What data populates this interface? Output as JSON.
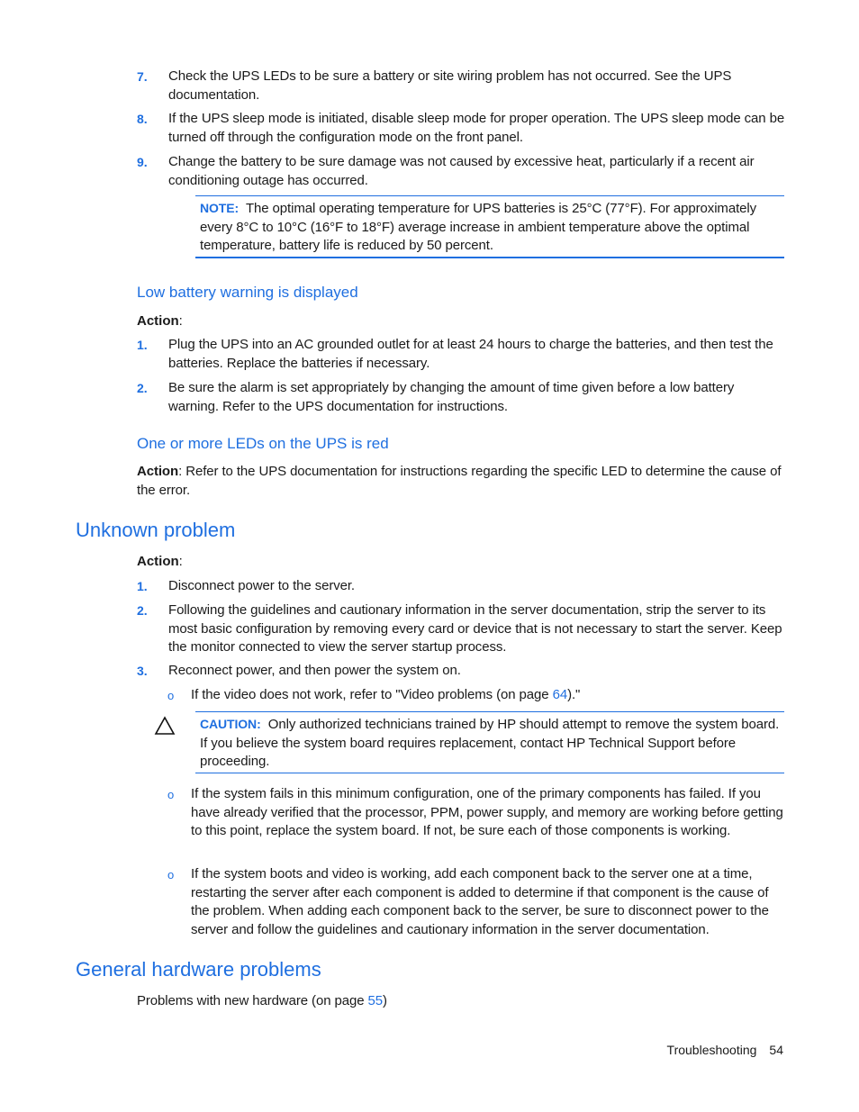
{
  "colors": {
    "accent": "#1f6fe0",
    "text": "#1a1a1a"
  },
  "ups_steps": [
    {
      "num": "7.",
      "text": "Check the UPS LEDs to be sure a battery or site wiring problem has not occurred. See the UPS documentation."
    },
    {
      "num": "8.",
      "text": "If the UPS sleep mode is initiated, disable sleep mode for proper operation. The UPS sleep mode can be turned off through the configuration mode on the front panel."
    },
    {
      "num": "9.",
      "text": "Change the battery to be sure damage was not caused by excessive heat, particularly if a recent air conditioning outage has occurred."
    }
  ],
  "note": {
    "label": "NOTE:",
    "text": "The optimal operating temperature for UPS batteries is 25°C (77°F). For approximately every 8°C to 10°C (16°F to 18°F) average increase in ambient temperature above the optimal temperature, battery life is reduced by 50 percent."
  },
  "low_battery": {
    "heading": "Low battery warning is displayed",
    "action_label": "Action",
    "action_colon": ":",
    "steps": [
      {
        "num": "1.",
        "text": "Plug the UPS into an AC grounded outlet for at least 24 hours to charge the batteries, and then test the batteries. Replace the batteries if necessary."
      },
      {
        "num": "2.",
        "text": "Be sure the alarm is set appropriately by changing the amount of time given before a low battery warning. Refer to the UPS documentation for instructions."
      }
    ]
  },
  "leds_red": {
    "heading": "One or more LEDs on the UPS is red",
    "action_label": "Action",
    "action_text": ": Refer to the UPS documentation for instructions regarding the specific LED to determine the cause of the error."
  },
  "unknown_problem": {
    "heading": "Unknown problem",
    "action_label": "Action",
    "action_colon": ":",
    "steps": [
      {
        "num": "1.",
        "text": "Disconnect power to the server."
      },
      {
        "num": "2.",
        "text": "Following the guidelines and cautionary information in the server documentation, strip the server to its most basic configuration by removing every card or device that is not necessary to start the server. Keep the monitor connected to view the server startup process."
      },
      {
        "num": "3.",
        "text": "Reconnect power, and then power the system on."
      }
    ],
    "sub_bullet_symbol": "o",
    "video_sub": {
      "before": "If the video does not work, refer to \"Video problems (on page ",
      "link": "64",
      "after": ").\""
    },
    "caution": {
      "icon": "warning-triangle-icon",
      "label": "CAUTION:",
      "text": "Only authorized technicians trained by HP should attempt to remove the system board. If you believe the system board requires replacement, contact HP Technical Support before proceeding."
    },
    "subs": [
      "If the system fails in this minimum configuration, one of the primary components has failed. If you have already verified that the processor, PPM, power supply, and memory are working before getting to this point, replace the system board. If not, be sure each of those components is working.",
      "If the system boots and video is working, add each component back to the server one at a time, restarting the server after each component is added to determine if that component is the cause of the problem. When adding each component back to the server, be sure to disconnect power to the server and follow the guidelines and cautionary information in the server documentation."
    ]
  },
  "general_hardware": {
    "heading": "General hardware problems",
    "item": {
      "before": "Problems with new hardware (on page ",
      "link": "55",
      "after": ")"
    }
  },
  "footer": {
    "section": "Troubleshooting",
    "page": "54"
  }
}
